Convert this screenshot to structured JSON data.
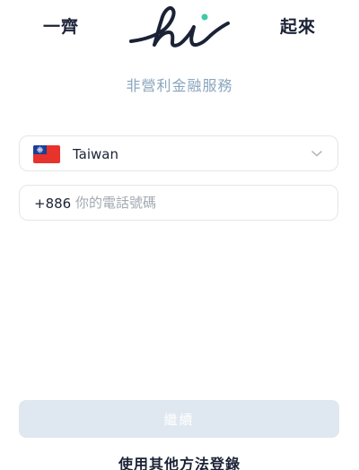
{
  "header": {
    "left_text": "一齊",
    "logo_text": "hi",
    "right_text": "起來"
  },
  "subtitle": "非營利金融服務",
  "country_selector": {
    "flag_icon": "taiwan-flag-icon",
    "country_name": "Taiwan",
    "chevron_icon": "chevron-down-icon"
  },
  "phone": {
    "dial_code": "+886",
    "placeholder": "你的電話號碼",
    "value": ""
  },
  "continue_button": {
    "label": "繼續",
    "state": "disabled"
  },
  "other_login_link": "使用其他方法登錄",
  "colors": {
    "brand_navy": "#1b2235",
    "logo_dot": "#3ec9a7",
    "subtitle": "#8aa4bd",
    "button_disabled_bg": "#dfe7f0",
    "border": "#e3e6ea"
  }
}
